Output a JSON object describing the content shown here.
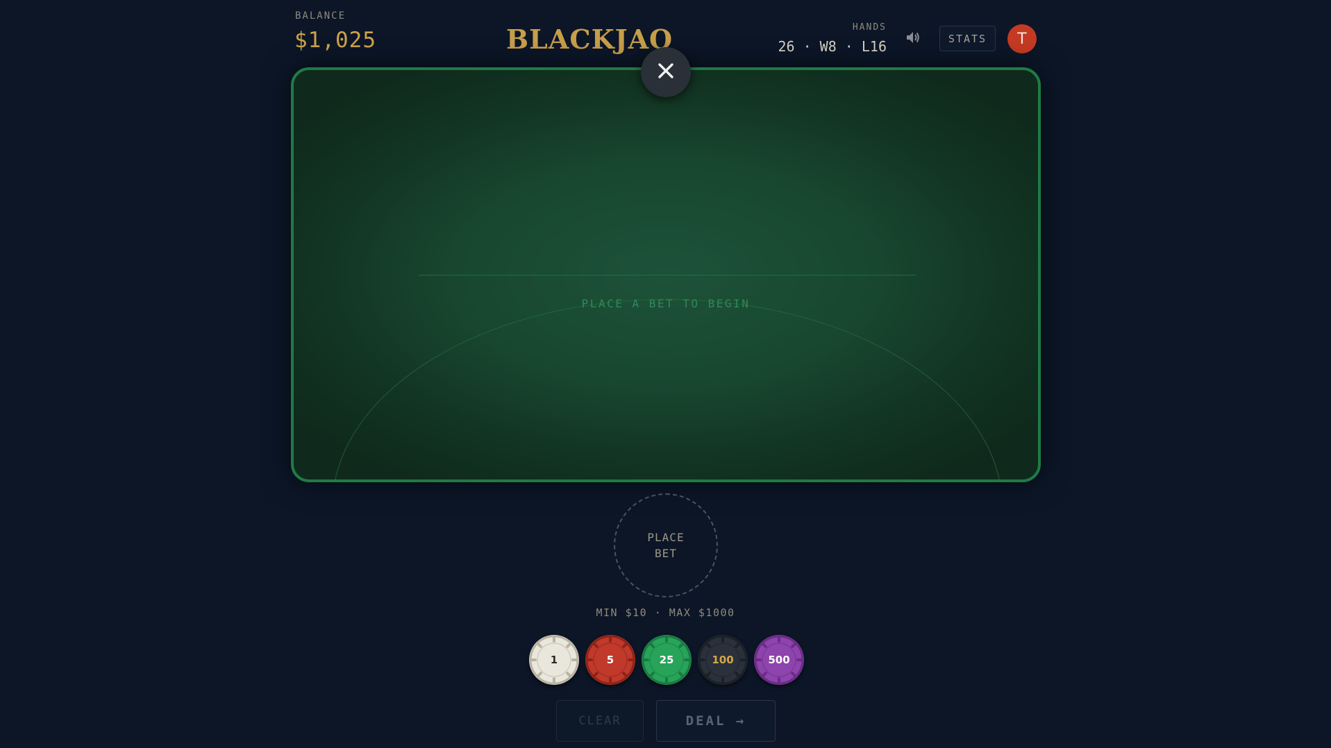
{
  "header": {
    "balance_label": "BALANCE",
    "balance_value": "$1,025",
    "logo": "BLACKJAQ",
    "hands_label": "HANDS",
    "hands_value": "26 · W8 · L16",
    "sound_icon": "speaker-volume-icon",
    "stats_label": "STATS",
    "avatar_initial": "T"
  },
  "table": {
    "close_icon": "close-icon",
    "prompt": "PLACE A BET TO BEGIN"
  },
  "bet": {
    "spot_line1": "PLACE",
    "spot_line2": "BET",
    "limits": "MIN $10 · MAX $1000"
  },
  "chips": [
    {
      "label": "1",
      "color": "#e9e6dc",
      "edge": "#b9b3a3",
      "text": "#2a2a2a"
    },
    {
      "label": "5",
      "color": "#c0392b",
      "edge": "#8e2418",
      "text": "#ffffff"
    },
    {
      "label": "25",
      "color": "#27a35a",
      "edge": "#1a7a41",
      "text": "#ffffff"
    },
    {
      "label": "100",
      "color": "#2b313b",
      "edge": "#1c2027",
      "text": "#d4a64a"
    },
    {
      "label": "500",
      "color": "#8e44ad",
      "edge": "#6a2c86",
      "text": "#ffffff"
    }
  ],
  "actions": {
    "clear_label": "CLEAR",
    "deal_label": "DEAL →"
  },
  "colors": {
    "background": "#0c1627",
    "gold": "#cfa34a",
    "felt_border": "#1f7a45",
    "avatar": "#c53a22"
  }
}
